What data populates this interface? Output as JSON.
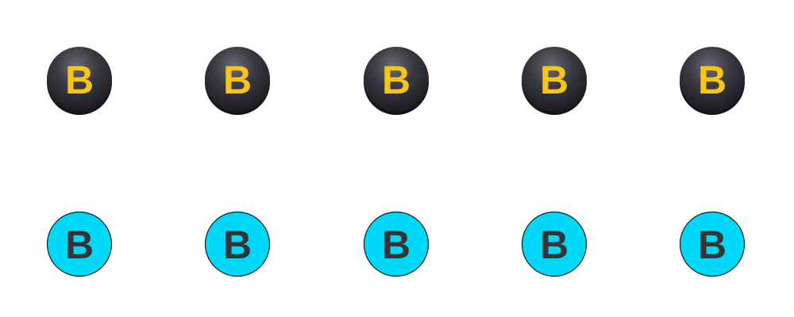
{
  "colors": {
    "dark_badge_fill": "#2e2d33",
    "dark_badge_letter": "#f5c518",
    "light_badge_fill": "#00d8f7",
    "light_badge_letter": "#333338",
    "light_badge_stroke": "#1a1a1a"
  },
  "rows": {
    "dark": {
      "icon": "b-letter-badge-dark-icon",
      "items": [
        {
          "letter": "B"
        },
        {
          "letter": "B"
        },
        {
          "letter": "B"
        },
        {
          "letter": "B"
        },
        {
          "letter": "B"
        }
      ]
    },
    "light": {
      "icon": "b-letter-badge-cyan-icon",
      "items": [
        {
          "letter": "B"
        },
        {
          "letter": "B"
        },
        {
          "letter": "B"
        },
        {
          "letter": "B"
        },
        {
          "letter": "B"
        }
      ]
    }
  }
}
